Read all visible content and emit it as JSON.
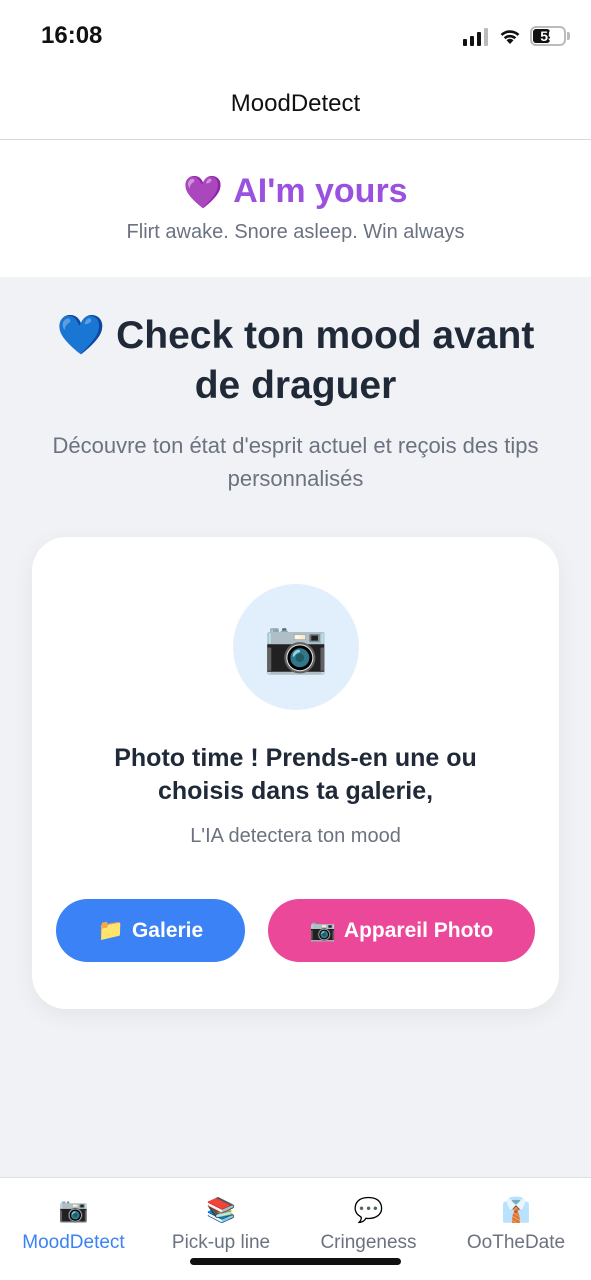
{
  "status_bar": {
    "time": "16:08",
    "battery": "55"
  },
  "header": {
    "title": "MoodDetect"
  },
  "brand": {
    "emoji": "💜",
    "title": "AI'm yours",
    "tagline": "Flirt awake. Snore asleep. Win always"
  },
  "hero": {
    "emoji": "💙",
    "title": "Check ton mood avant de draguer",
    "subtitle": "Découvre ton état d'esprit actuel et reçois des tips personnalisés"
  },
  "card": {
    "icon": "📷",
    "title": "Photo time ! Prends-en une ou choisis dans ta galerie,",
    "subtitle": "L'IA detectera ton mood",
    "gallery_button": {
      "icon": "📁",
      "label": "Galerie"
    },
    "camera_button": {
      "icon": "📷",
      "label": "Appareil Photo"
    }
  },
  "tabs": [
    {
      "icon": "📷",
      "label": "MoodDetect",
      "active": true
    },
    {
      "icon": "📚",
      "label": "Pick-up line",
      "active": false
    },
    {
      "icon": "💬",
      "label": "Cringeness",
      "active": false
    },
    {
      "icon": "👔",
      "label": "OoTheDate",
      "active": false
    }
  ],
  "colors": {
    "brand_purple": "#9b51e0",
    "accent_blue": "#3b82f6",
    "accent_pink": "#ec4899",
    "background": "#f0f2f6"
  }
}
